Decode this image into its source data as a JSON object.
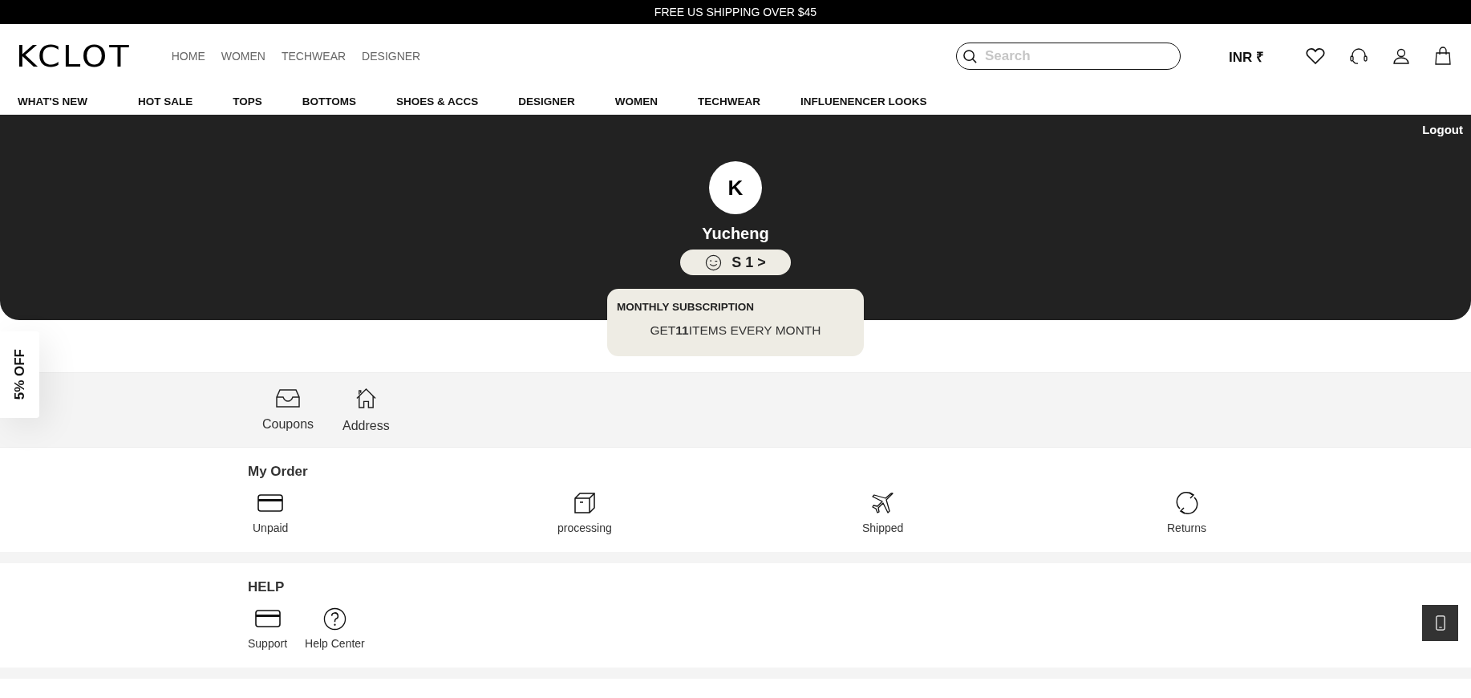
{
  "announcement": "FREE US SHIPPING OVER $45",
  "header": {
    "logo": "KCLOT",
    "nav": [
      "HOME",
      "WOMEN",
      "TECHWEAR",
      "DESIGNER"
    ],
    "search": {
      "placeholder": "Search"
    },
    "currency": "INR ₹"
  },
  "categories": [
    "WHAT'S NEW",
    "HOT SALE",
    "TOPS",
    "BOTTOMS",
    "SHOES & ACCS",
    "DESIGNER",
    "WOMEN",
    "TECHWEAR",
    "INFLUENENCER LOOKS"
  ],
  "profile": {
    "logout": "Logout",
    "initial": "K",
    "name": "Yucheng",
    "level": "S 1 >"
  },
  "subscription": {
    "title": "MONTHLY SUBSCRIPTION",
    "text": "GET**11**ITEMS EVERY MONTH"
  },
  "quick_links": [
    {
      "label": "Coupons",
      "kind": "inbox"
    },
    {
      "label": "Address",
      "kind": "house"
    }
  ],
  "orders": {
    "title": "My Order",
    "items": [
      {
        "label": "Unpaid",
        "kind": "card"
      },
      {
        "label": "processing",
        "kind": "box"
      },
      {
        "label": "Shipped",
        "kind": "plane"
      },
      {
        "label": "Returns",
        "kind": "cycle"
      }
    ]
  },
  "help": {
    "title": "HELP",
    "items": [
      {
        "label": "Support",
        "kind": "card"
      },
      {
        "label": "Help Center",
        "kind": "question"
      }
    ]
  },
  "promo_tab": "5% OFF"
}
